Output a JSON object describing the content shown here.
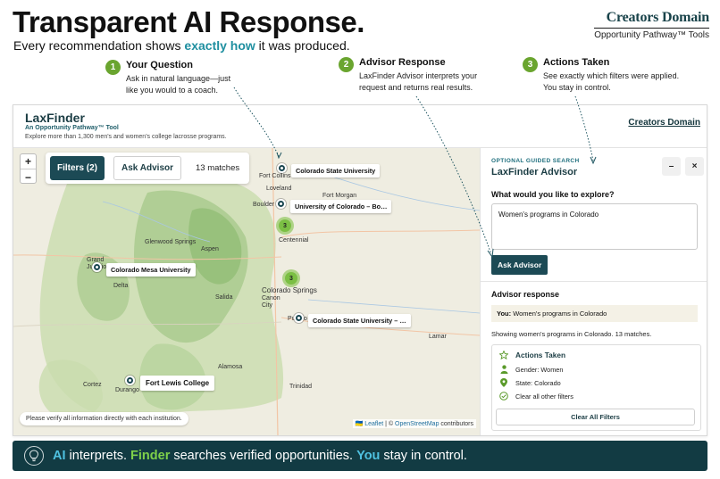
{
  "hero": {
    "title": "Transparent AI Response.",
    "subtitle_pre": "Every recommendation shows ",
    "subtitle_highlight": "exactly how",
    "subtitle_post": " it was produced."
  },
  "brand": {
    "name": "Creators Domain",
    "tagline": "Opportunity Pathway™ Tools"
  },
  "steps": [
    {
      "num": "1",
      "title": "Your Question",
      "desc_line1": "Ask in natural language—just",
      "desc_line2": "like you would to a coach."
    },
    {
      "num": "2",
      "title": "Advisor Response",
      "desc_line1": "LaxFinder Advisor interprets your",
      "desc_line2": "request and returns real results."
    },
    {
      "num": "3",
      "title": "Actions Taken",
      "desc_line1": "See exactly which filters were applied.",
      "desc_line2": "You stay in control."
    }
  ],
  "app": {
    "name": "LaxFinder",
    "tool": "An Opportunity Pathway™ Tool",
    "description": "Explore more than 1,300 men's and women's college lacrosse programs.",
    "header_link": "Creators Domain"
  },
  "map": {
    "zoom_in": "+",
    "zoom_out": "−",
    "filters_button": "Filters (2)",
    "ask_button": "Ask Advisor",
    "matches": "13 matches",
    "markers": [
      "Colorado State University",
      "University of Colorado – Bo…",
      "Colorado Mesa University",
      "Colorado State University – …",
      "Fort Lewis College"
    ],
    "clusters": [
      "3",
      "3"
    ],
    "towns": [
      "Fort Collins",
      "Loveland",
      "Fort Morgan",
      "Boulder",
      "Centennial",
      "Glenwood Springs",
      "Aspen",
      "Grand Junction",
      "Delta",
      "Salida",
      "Colorado Springs",
      "Canon City",
      "Pueblo",
      "Lamar",
      "Alamosa",
      "Trinidad",
      "Cortez",
      "Durango"
    ],
    "disclaimer": "Please verify all information directly with each institution.",
    "attribution_flag": "🇺🇦",
    "attribution_leaflet": "Leaflet",
    "attribution_sep": " | © ",
    "attribution_osm": "OpenStreetMap",
    "attribution_tail": " contributors"
  },
  "panel": {
    "kicker": "OPTIONAL GUIDED SEARCH",
    "title": "LaxFinder Advisor",
    "minimize": "–",
    "close": "×",
    "question_label": "What would you like to explore?",
    "input_value": "Women's programs in Colorado",
    "ask_button": "Ask Advisor",
    "response_title": "Advisor response",
    "you_label": "You:",
    "you_text": " Women's programs in Colorado",
    "showing": "Showing women's programs in Colorado. 13 matches.",
    "actions_title": "Actions Taken",
    "actions": [
      "Gender: Women",
      "State: Colorado",
      "Clear all other filters"
    ],
    "clear_button": "Clear All Filters"
  },
  "banner": {
    "ai": "AI",
    "t1": " interprets. ",
    "finder": "Finder",
    "t2": " searches verified opportunities. ",
    "you": "You",
    "t3": " stay in control."
  },
  "colors": {
    "brand_teal": "#1c4a55",
    "accent_green": "#6aa52f",
    "highlight_blue": "#1f8fa0",
    "banner_bg": "#123b43"
  }
}
